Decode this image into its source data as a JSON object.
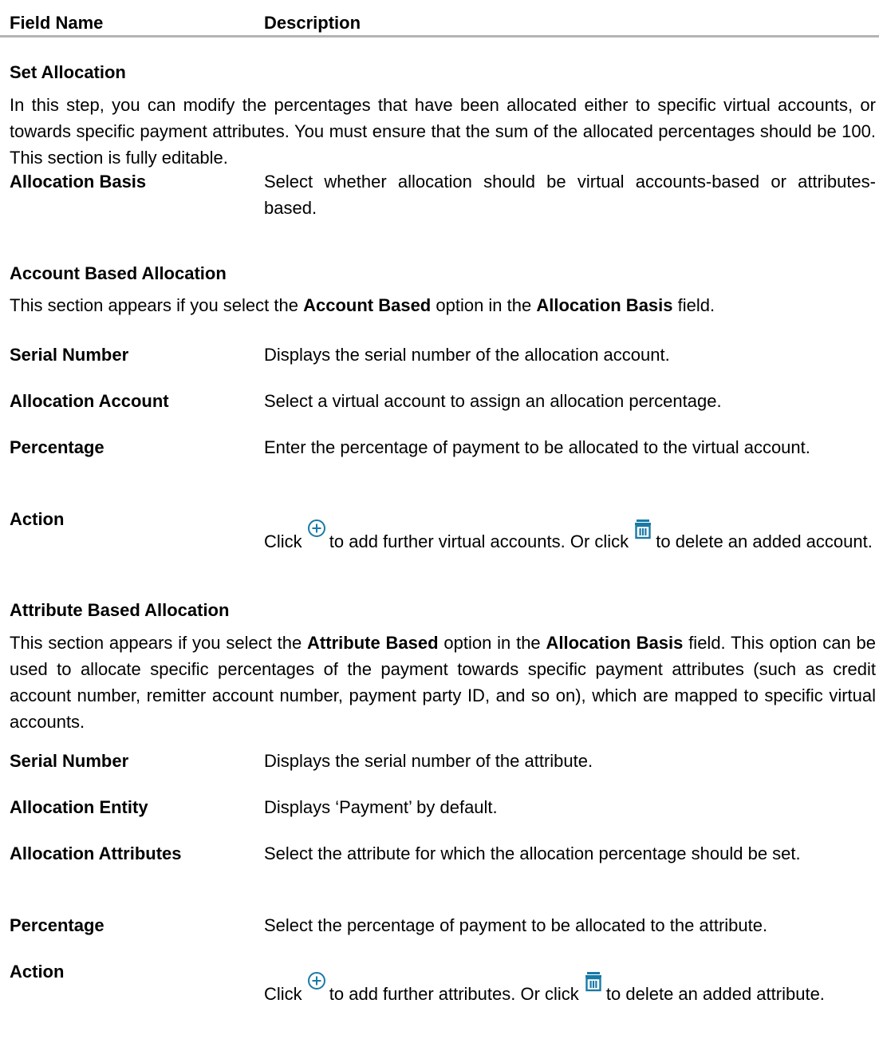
{
  "header": {
    "field_name": "Field Name",
    "description": "Description"
  },
  "set_allocation": {
    "title": "Set Allocation",
    "intro": "In this step, you can modify the percentages that have been allocated either to specific virtual accounts, or towards specific payment attributes. You must ensure that the sum of the allocated percentages should be 100. This section is fully editable.",
    "rows": [
      {
        "name": "Allocation Basis",
        "desc": "Select whether allocation should be virtual accounts-based or attributes-based."
      }
    ]
  },
  "account_based": {
    "title": "Account Based Allocation",
    "intro_pre": "This section appears if you select the ",
    "intro_b1": "Account Based",
    "intro_mid": " option in the ",
    "intro_b2": "Allocation Basis",
    "intro_post": " field.",
    "rows": [
      {
        "name": "Serial Number",
        "desc": "Displays the serial number of the allocation account."
      },
      {
        "name": "Allocation Account",
        "desc": "Select a virtual account to assign an allocation percentage."
      },
      {
        "name": "Percentage",
        "desc": "Enter the percentage of payment to be allocated to the virtual account."
      }
    ],
    "action": {
      "name": "Action",
      "pre": "Click ",
      "mid": "to add further virtual accounts. Or click ",
      "post": "to delete an added account."
    }
  },
  "attribute_based": {
    "title": "Attribute Based Allocation",
    "intro_pre": "This section appears if you select the ",
    "intro_b1": "Attribute Based",
    "intro_mid": " option in the ",
    "intro_b2": "Allocation Basis",
    "intro_post": " field. This option can be used to allocate specific percentages of the payment towards specific payment attributes (such as credit account number, remitter account number, payment party ID, and so on), which are mapped to specific virtual accounts.",
    "rows": [
      {
        "name": "Serial Number",
        "desc": "Displays the serial number of the attribute."
      },
      {
        "name": "Allocation Entity",
        "desc": "Displays ‘Payment’ by default."
      },
      {
        "name": "Allocation Attributes",
        "desc": "Select the attribute for which the allocation percentage should be set."
      },
      {
        "name": "Percentage",
        "desc": "Select the percentage of payment to be allocated to the attribute."
      }
    ],
    "action": {
      "name": "Action",
      "pre": "Click ",
      "mid": "to add further attributes. Or click ",
      "post": "to delete an added attribute."
    }
  },
  "icons": {
    "add": "plus-circle-icon",
    "delete": "trash-icon",
    "color": "#1a7aa6"
  }
}
